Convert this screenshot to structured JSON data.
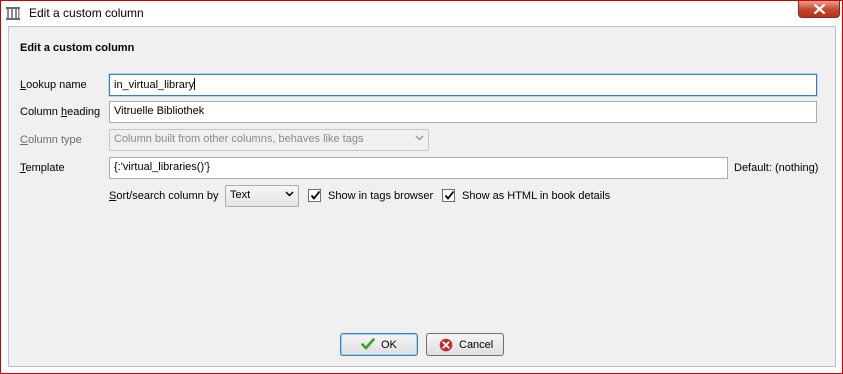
{
  "window": {
    "title": "Edit a custom column"
  },
  "dialog": {
    "heading": "Edit a custom column",
    "lookup_name": {
      "label_u": "L",
      "label_rest": "ookup name",
      "value": "in_virtual_library"
    },
    "column_heading": {
      "label_pre": "Column ",
      "label_u": "h",
      "label_rest": "eading",
      "value": "Vitruelle Bibliothek"
    },
    "column_type": {
      "label_pre": "",
      "label_u": "C",
      "label_rest": "olumn type",
      "value": "Column built from other columns, behaves like tags"
    },
    "template": {
      "label_u": "T",
      "label_rest": "emplate",
      "value": "{:'virtual_libraries()'}",
      "default_text": "Default: (nothing)"
    },
    "sort": {
      "label_u": "S",
      "label_rest": "ort/search column by",
      "value": "Text"
    },
    "show_in_tags_browser": {
      "label": "Show in tags browser",
      "checked": true
    },
    "show_as_html": {
      "label": "Show as HTML in book details",
      "checked": true
    }
  },
  "buttons": {
    "ok": "OK",
    "cancel": "Cancel"
  },
  "colors": {
    "focus": "#3d7bc3",
    "window_border": "#d40000",
    "ok_icon": "#3aa12b",
    "cancel_icon": "#c62828"
  }
}
